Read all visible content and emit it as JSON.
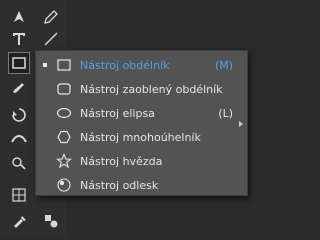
{
  "flyout": {
    "items": [
      {
        "label": "Nástroj obdélník",
        "shortcut": "(M)",
        "icon": "rectangle-icon",
        "selected": true
      },
      {
        "label": "Nástroj zaoblený obdélník",
        "shortcut": "",
        "icon": "rounded-rectangle-icon",
        "selected": false
      },
      {
        "label": "Nástroj elipsa",
        "shortcut": "(L)",
        "icon": "ellipse-icon",
        "selected": false
      },
      {
        "label": "Nástroj mnohoúhelník",
        "shortcut": "",
        "icon": "polygon-icon",
        "selected": false
      },
      {
        "label": "Nástroj hvězda",
        "shortcut": "",
        "icon": "star-icon",
        "selected": false
      },
      {
        "label": "Nástroj odlesk",
        "shortcut": "",
        "icon": "flare-icon",
        "selected": false
      }
    ]
  },
  "colors": {
    "accent": "#54a3e8",
    "menu_bg": "#535353",
    "toolbar_bg": "#2e2e2e"
  }
}
